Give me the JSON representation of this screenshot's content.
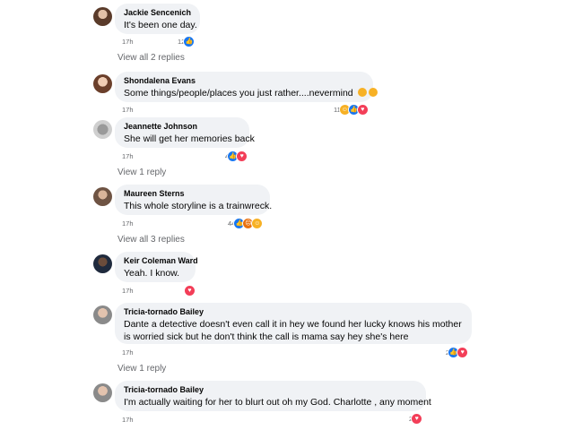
{
  "comments": [
    {
      "name": "Jackie Sencenich",
      "text": "It's been one day.",
      "time": "17h",
      "reaction_count": "12",
      "reactions": [
        "like-icon"
      ],
      "view_replies": "View all 2 replies"
    },
    {
      "name": "Shondalena Evans",
      "text": "Some things/people/places you just rather....nevermind",
      "time": "17h",
      "reaction_count": "11",
      "reactions": [
        "haha-icon",
        "like-icon",
        "love-icon"
      ],
      "view_replies": ""
    },
    {
      "name": "Jeannette Johnson",
      "text": "She will get her memories back",
      "time": "17h",
      "reaction_count": "4",
      "reactions": [
        "like-icon",
        "love-icon"
      ],
      "view_replies": "View 1 reply"
    },
    {
      "name": "Maureen Sterns",
      "text": "This whole storyline is a trainwreck.",
      "time": "17h",
      "reaction_count": "44",
      "reactions": [
        "like-icon",
        "angry-icon",
        "haha-icon"
      ],
      "view_replies": "View all 3 replies"
    },
    {
      "name": "Keir Coleman Ward",
      "text": "Yeah. I know.",
      "time": "17h",
      "reaction_count": "",
      "reactions": [
        "love-icon"
      ],
      "view_replies": ""
    },
    {
      "name": "Tricia-tornado Bailey",
      "text": "Dante a detective doesn't even call it in hey we found her lucky knows his mother is worried sick but he don't think the call is mama say hey she's here",
      "time": "17h",
      "reaction_count": "2",
      "reactions": [
        "like-icon",
        "love-icon"
      ],
      "view_replies": "View 1 reply"
    },
    {
      "name": "Tricia-tornado Bailey",
      "text": "I'm actually waiting for her to blurt out oh my God. Charlotte , any moment",
      "time": "17h",
      "reaction_count": "2",
      "reactions": [
        "love-icon"
      ],
      "view_replies": ""
    }
  ],
  "colors": {
    "bubble": "#f0f2f5",
    "like": "#1877f2",
    "love": "#f33e58",
    "haha": "#f7b125",
    "meta": "#65676b"
  }
}
